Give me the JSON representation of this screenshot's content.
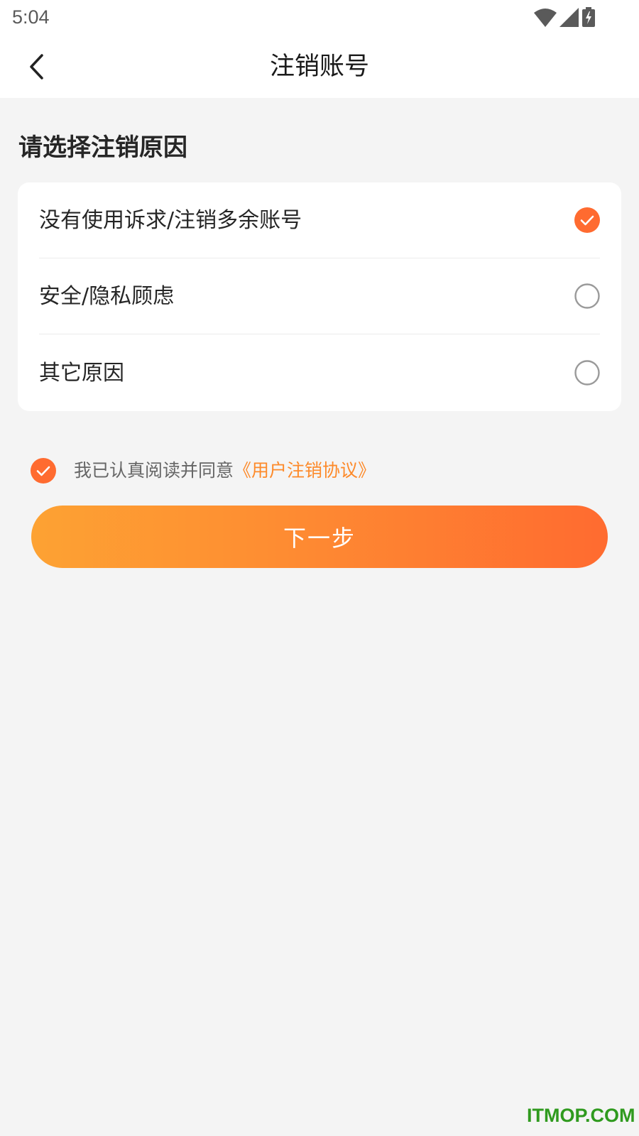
{
  "status_bar": {
    "time": "5:04",
    "icons": [
      "wifi-icon",
      "cell-signal-icon",
      "battery-charging-icon"
    ]
  },
  "nav": {
    "title": "注销账号",
    "back_icon": "chevron-left-icon"
  },
  "section": {
    "heading": "请选择注销原因"
  },
  "reasons": [
    {
      "label": "没有使用诉求/注销多余账号",
      "selected": true
    },
    {
      "label": "安全/隐私顾虑",
      "selected": false
    },
    {
      "label": "其它原因",
      "selected": false
    }
  ],
  "agreement": {
    "checked": true,
    "text": "我已认真阅读并同意",
    "link": "《用户注销协议》"
  },
  "next_button": {
    "label": "下一步"
  },
  "watermark": "ITMOP.COM",
  "colors": {
    "accent": "#ff6b30",
    "link": "#fd8a2a",
    "background": "#f4f4f4",
    "watermark": "#2f9a1e"
  }
}
